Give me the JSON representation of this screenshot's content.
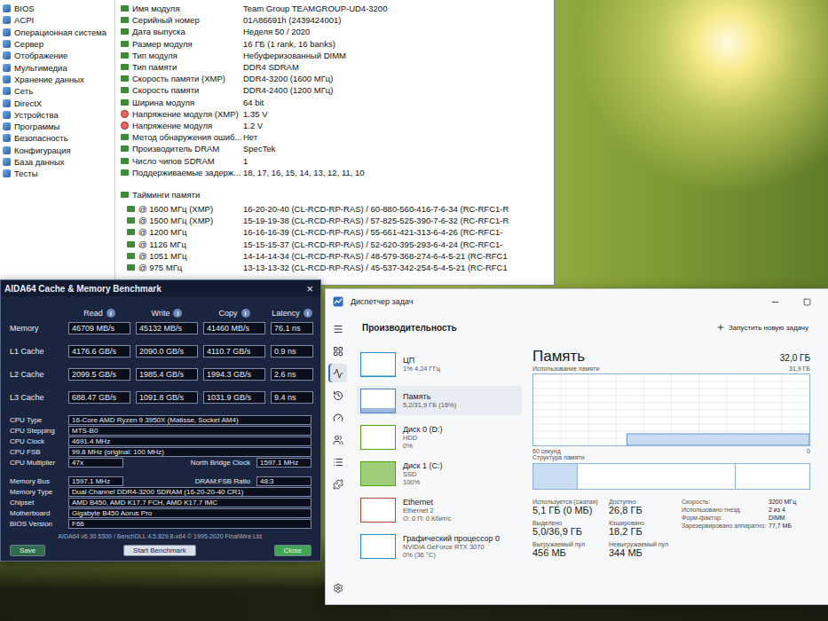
{
  "aida_main": {
    "tree": [
      "BIOS",
      "ACPI",
      "Операционная система",
      "Сервер",
      "Отображение",
      "Мультимедиа",
      "Хранение данных",
      "Сеть",
      "DirectX",
      "Устройства",
      "Программы",
      "Безопасность",
      "Конфигурация",
      "База данных",
      "Тесты"
    ],
    "properties": [
      {
        "label": "Имя модуля",
        "value": "Team Group TEAMGROUP-UD4-3200",
        "kind": "chip"
      },
      {
        "label": "Серийный номер",
        "value": "01A86691h (2439424001)",
        "kind": "chip"
      },
      {
        "label": "Дата выпуска",
        "value": "Неделя 50 / 2020",
        "kind": "chip"
      },
      {
        "label": "Размер модуля",
        "value": "16 ГБ (1 rank, 16 banks)",
        "kind": "chip"
      },
      {
        "label": "Тип модуля",
        "value": "Небуферизованный DIMM",
        "kind": "chip"
      },
      {
        "label": "Тип памяти",
        "value": "DDR4 SDRAM",
        "kind": "chip"
      },
      {
        "label": "Скорость памяти (XMP)",
        "value": "DDR4-3200 (1600 МГц)",
        "kind": "chip"
      },
      {
        "label": "Скорость памяти",
        "value": "DDR4-2400 (1200 МГц)",
        "kind": "chip"
      },
      {
        "label": "Ширина модуля",
        "value": "64 bit",
        "kind": "chip"
      },
      {
        "label": "Напряжение модуля (XMP)",
        "value": "1.35 V",
        "kind": "voltage"
      },
      {
        "label": "Напряжение модуля",
        "value": "1.2 V",
        "kind": "voltage"
      },
      {
        "label": "Метод обнаружения ошиб...",
        "value": "Нет",
        "kind": "chip"
      },
      {
        "label": "Производитель DRAM",
        "value": "SpecTek",
        "kind": "chip"
      },
      {
        "label": "Число чипов SDRAM",
        "value": "1",
        "kind": "chip"
      },
      {
        "label": "Поддерживаемые задерж...",
        "value": "18, 17, 16, 15, 14, 13, 12, 11, 10",
        "kind": "chip"
      }
    ],
    "timings_title": "Тайминги памяти",
    "timings": [
      {
        "label": "@ 1600 МГц (XMP)",
        "value": "16-20-20-40 (CL-RCD-RP-RAS) / 60-880-560-416-7-6-34 (RC-RFC1-R"
      },
      {
        "label": "@ 1500 МГц (XMP)",
        "value": "15-19-19-38 (CL-RCD-RP-RAS) / 57-825-525-390-7-6-32 (RC-RFC1-R"
      },
      {
        "label": "@ 1200 МГц",
        "value": "16-16-16-39 (CL-RCD-RP-RAS) / 55-661-421-313-6-4-26 (RC-RFC1-"
      },
      {
        "label": "@ 1126 МГц",
        "value": "15-15-15-37 (CL-RCD-RP-RAS) / 52-620-395-293-6-4-24 (RC-RFC1-"
      },
      {
        "label": "@ 1051 МГц",
        "value": "14-14-14-34 (CL-RCD-RP-RAS) / 48-579-368-274-6-4-5-21 (RC-RFC1"
      },
      {
        "label": "@ 975 МГц",
        "value": "13-13-13-32 (CL-RCD-RP-RAS) / 45-537-342-254-5-4-5-21 (RC-RFC1"
      }
    ]
  },
  "benchmark": {
    "title": "AIDA64 Cache & Memory Benchmark",
    "close": "×",
    "info_icon": "i",
    "columns": [
      "Read",
      "Write",
      "Copy",
      "Latency"
    ],
    "results": [
      {
        "name": "Memory",
        "values": [
          "46709 MB/s",
          "45132 MB/s",
          "41460 MB/s",
          "76.1 ns"
        ]
      },
      {
        "name": "L1 Cache",
        "values": [
          "4176.6 GB/s",
          "2090.0 GB/s",
          "4110.7 GB/s",
          "0.9 ns"
        ]
      },
      {
        "name": "L2 Cache",
        "values": [
          "2099.5 GB/s",
          "1985.4 GB/s",
          "1994.3 GB/s",
          "2.6 ns"
        ]
      },
      {
        "name": "L3 Cache",
        "values": [
          "688.47 GB/s",
          "1091.8 GB/s",
          "1031.9 GB/s",
          "9.4 ns"
        ]
      }
    ],
    "cpu_info": [
      {
        "label": "CPU Type",
        "value": "16-Core AMD Ryzen 9 3950X (Matisse, Socket AM4)"
      },
      {
        "label": "CPU Stepping",
        "value": "MTS-B0"
      },
      {
        "label": "CPU Clock",
        "value": "4691.4 MHz"
      },
      {
        "label": "CPU FSB",
        "value": "99.8 MHz (original: 100 MHz)"
      },
      {
        "label": "CPU Multiplier",
        "value": "47x",
        "extra_label": "North Bridge Clock",
        "extra_value": "1597.1 MHz"
      }
    ],
    "memory_info": [
      {
        "label": "Memory Bus",
        "value": "1597.1 MHz",
        "extra_label": "DRAM:FSB Ratio",
        "extra_value": "48:3"
      },
      {
        "label": "Memory Type",
        "value": "Dual Channel DDR4-3200 SDRAM (16-20-20-40 CR1)"
      },
      {
        "label": "Chipset",
        "value": "AMD B450, AMD K17.7 FCH, AMD K17.7 IMC"
      },
      {
        "label": "Motherboard",
        "value": "Gigabyte B450 Aorus Pro"
      },
      {
        "label": "BIOS Version",
        "value": "F66"
      }
    ],
    "footer": "AIDA64 v6.30.5300 / BenchDLL 4.5.829.8-x64 © 1995-2020 FinalWire Ltd.",
    "buttons": [
      "Save",
      "Start Benchmark",
      "Close"
    ]
  },
  "task_manager": {
    "title": "Диспетчер задач",
    "heading": "Производительность",
    "new_task": "Запустить новую задачу",
    "nav": [
      {
        "selected": false
      },
      {
        "selected": true
      },
      {
        "selected": false
      },
      {
        "selected": false
      },
      {
        "selected": false
      },
      {
        "selected": false
      },
      {
        "selected": false
      },
      {
        "selected": false
      }
    ],
    "devices": [
      {
        "name": "ЦП",
        "lines": [
          "1% 4,24 ГГц"
        ],
        "level": 0.01,
        "color": "#1f8fd1",
        "selected": false
      },
      {
        "name": "Память",
        "lines": [
          "5,2/31,9 ГБ (16%)"
        ],
        "level": 0.16,
        "color": "#4f7fc4",
        "selected": true
      },
      {
        "name": "Диск 0 (D:)",
        "lines": [
          "HDD",
          "0%"
        ],
        "level": 0,
        "color": "#4da60c",
        "selected": false
      },
      {
        "name": "Диск 1 (C:)",
        "lines": [
          "SSD",
          "100%"
        ],
        "level": 1,
        "color": "#4da60c",
        "selected": false
      },
      {
        "name": "Ethernet",
        "lines": [
          "Ethernet 2",
          "О: 0 П: 0 Кбит/с"
        ],
        "level": 0,
        "color": "#b5482a",
        "selected": false
      },
      {
        "name": "Графический процессор 0",
        "lines": [
          "NVIDIA GeForce RTX 3070",
          "0% (36 °C)"
        ],
        "level": 0,
        "color": "#1f8fd1",
        "selected": false
      }
    ],
    "detail": {
      "title": "Память",
      "capacity": "32,0 ГБ",
      "usage_label": "Использование памяти",
      "usage_max": "31,9 ГБ",
      "axis_left": "60 секунд",
      "axis_right": "0",
      "structure_label": "Структура памяти",
      "usage_points": [
        16.2,
        16.3,
        16.2,
        16.3,
        16.2,
        16.3,
        16.2,
        16.3,
        16.2,
        16.3,
        16.2,
        16.3,
        16.2,
        16.3,
        16.2,
        16.3,
        16.2,
        16.3,
        16.2,
        16.3,
        16.2,
        16.3,
        16.2,
        16.3,
        16.2,
        16.3,
        16.2,
        16.3,
        16.2,
        16.3,
        16.2,
        16.3,
        16.2,
        16.3,
        16.2,
        16.3,
        16.2,
        16.3,
        16.2,
        16.3
      ],
      "structure": [
        {
          "level": 0.16,
          "filled": true
        },
        {
          "level": 0.57,
          "filled": false
        },
        {
          "level": 0.27,
          "filled": false
        }
      ],
      "stats": [
        {
          "label": "Используется (сжатая)",
          "value": "5,1 ГБ (0 МБ)"
        },
        {
          "label": "Доступно",
          "value": "26,8 ГБ"
        },
        {
          "label": "Выделено",
          "value": "5,0/36,9 ГБ"
        },
        {
          "label": "Кэшировано",
          "value": "18,2 ГБ"
        },
        {
          "label": "Выгружаемый пул",
          "value": "456 МБ"
        },
        {
          "label": "Невыгружаемый пул",
          "value": "344 МБ"
        }
      ],
      "specs": [
        {
          "label": "Скорость:",
          "value": "3200 МГц"
        },
        {
          "label": "Использовано гнезд:",
          "value": "2 из 4"
        },
        {
          "label": "Форм-фактор:",
          "value": "DIMM"
        },
        {
          "label": "Зарезервировано аппаратно:",
          "value": "77,7 МБ"
        }
      ]
    }
  }
}
